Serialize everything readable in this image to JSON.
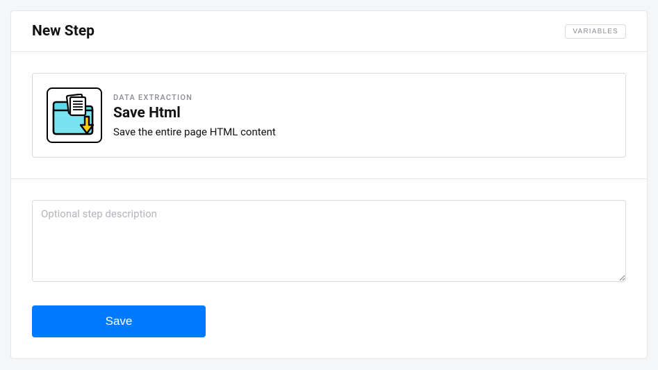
{
  "header": {
    "title": "New Step",
    "variables_label": "VARIABLES"
  },
  "step": {
    "category": "DATA EXTRACTION",
    "title": "Save Html",
    "description": "Save the entire page HTML content",
    "icon": "save-html-folder-icon"
  },
  "form": {
    "description_placeholder": "Optional step description",
    "description_value": "",
    "save_label": "Save"
  }
}
